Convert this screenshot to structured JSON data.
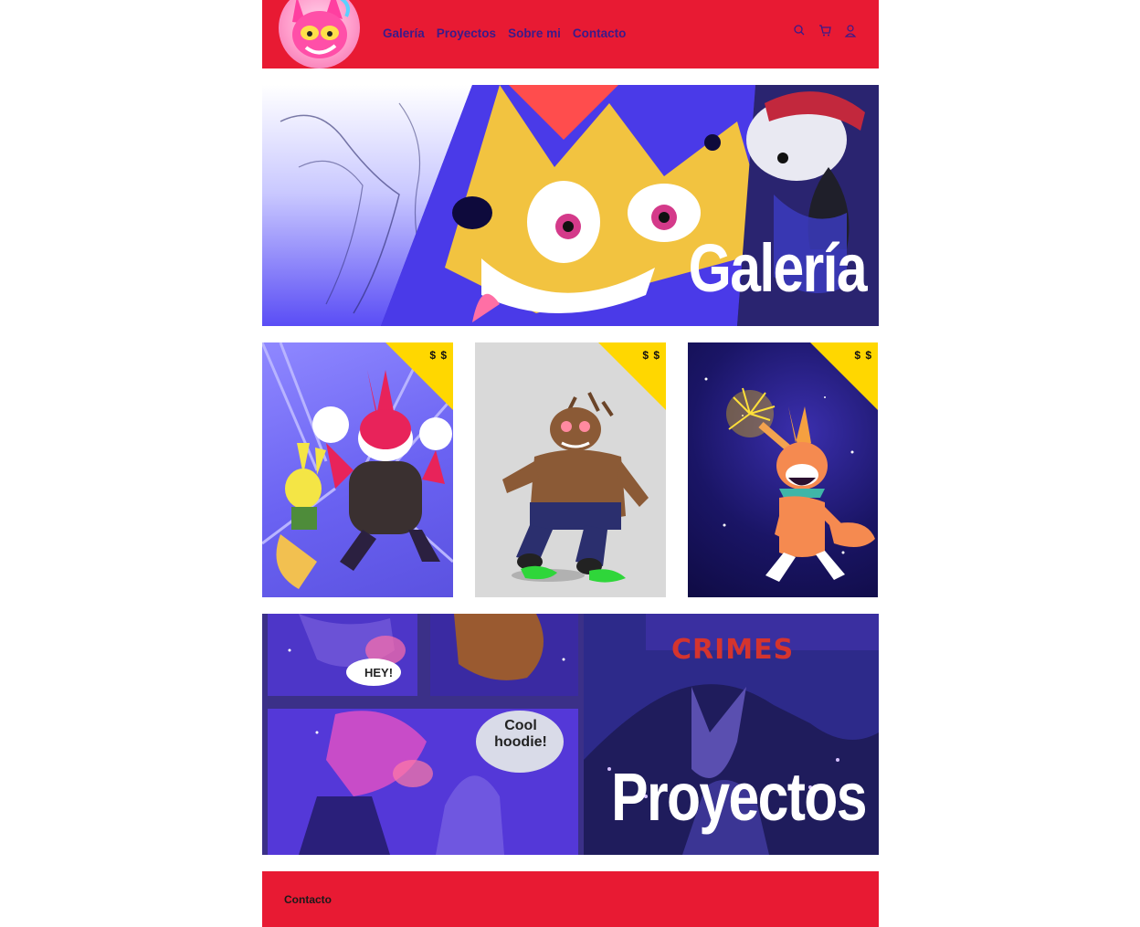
{
  "header": {
    "nav": [
      {
        "label": "Galería"
      },
      {
        "label": "Proyectos"
      },
      {
        "label": "Sobre mi"
      },
      {
        "label": "Contacto"
      }
    ],
    "icons": [
      "search-icon",
      "cart-icon",
      "user-icon"
    ]
  },
  "gallery_banner": {
    "title": "Galería"
  },
  "cards": [
    {
      "price": "$ $"
    },
    {
      "price": "$ $"
    },
    {
      "price": "$ $"
    }
  ],
  "projects_banner": {
    "title": "Proyectos",
    "comic_text_1": "HEY!",
    "comic_text_2": "Cool hoodie!",
    "logo_text": "CRIMES"
  },
  "footer": {
    "label": "Contacto"
  },
  "colors": {
    "brand_red": "#e81a33",
    "nav_text": "#3a1a8a",
    "price_tag": "#ffd700"
  }
}
